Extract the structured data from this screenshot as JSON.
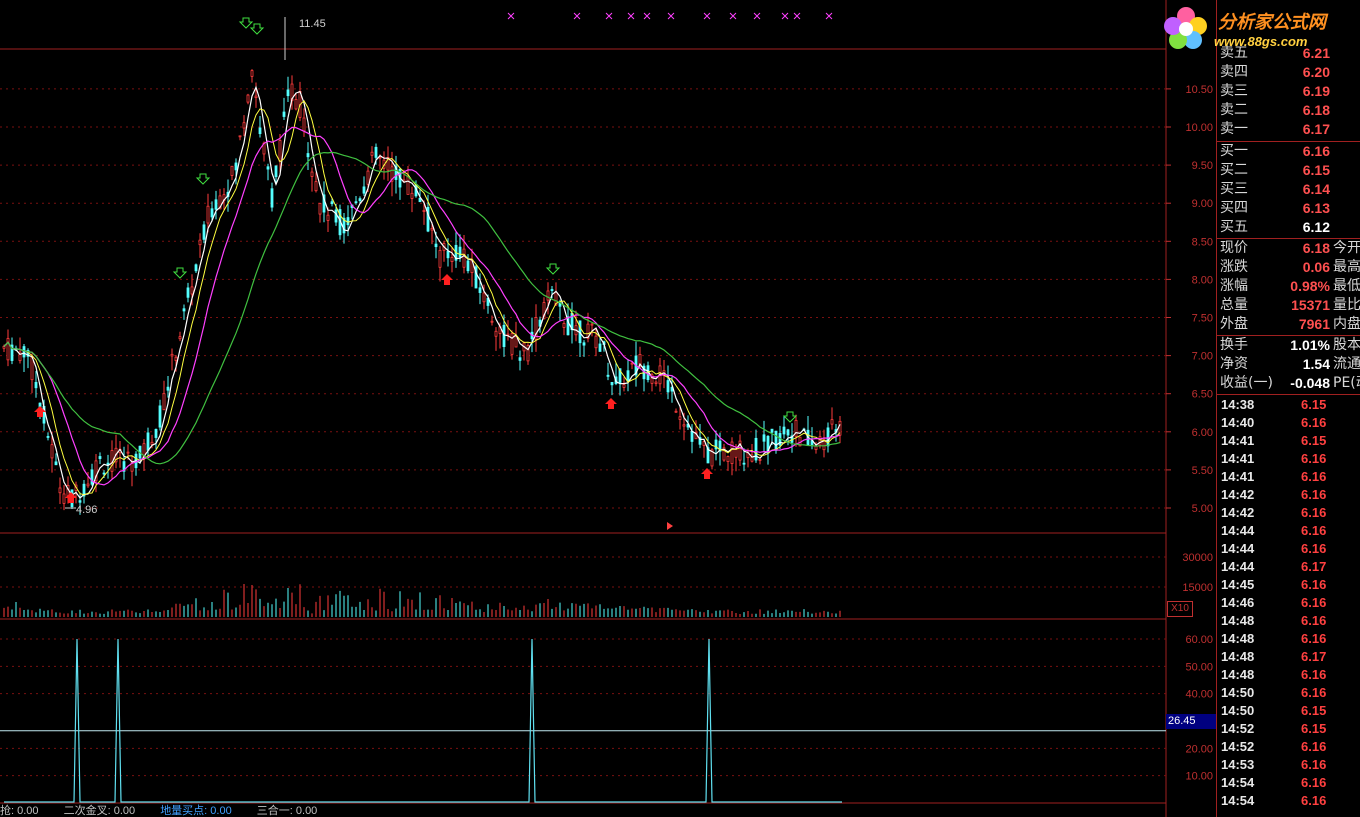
{
  "chart_area": {
    "price_axis_ticks": [
      "10.50",
      "10.00",
      "9.50",
      "9.00",
      "8.50",
      "8.00",
      "7.50",
      "7.00",
      "6.50",
      "6.00",
      "5.50",
      "5.00"
    ],
    "price_axis_values": [
      10.5,
      10.0,
      9.5,
      9.0,
      8.5,
      8.0,
      7.5,
      7.0,
      6.5,
      6.0,
      5.5,
      5.0
    ],
    "high_label": "11.45",
    "low_label": "4.96",
    "volume_axis_ticks": [
      "30000",
      "15000"
    ],
    "volume_axis_values": [
      30000,
      15000
    ],
    "volume_multiplier": "X10",
    "indicator_axis_ticks": [
      "60.00",
      "50.00",
      "40.00",
      "20.00",
      "10.00"
    ],
    "indicator_axis_values": [
      60,
      50,
      40,
      20,
      10
    ],
    "indicator_current": "26.45",
    "candle_up_color": "#ff3c3c",
    "candle_down_color": "#54ffff",
    "ma5_color": "#ffffff",
    "ma10_color": "#ffff40",
    "ma20_color": "#ff40ff",
    "ma60_color": "#40c040",
    "indicator_line_color": "#60e0f0"
  },
  "bottom_bar": {
    "items": [
      "抢: 0.00",
      "二次金叉: 0.00",
      "地量买点: 0.00",
      "三合一: 0.00"
    ]
  },
  "logo": {
    "text": "分析家公式网",
    "url": "www.88gs.com"
  },
  "quote_panel": {
    "sell": [
      {
        "label": "卖五",
        "value": "6.21"
      },
      {
        "label": "卖四",
        "value": "6.20"
      },
      {
        "label": "卖三",
        "value": "6.19"
      },
      {
        "label": "卖二",
        "value": "6.18"
      },
      {
        "label": "卖一",
        "value": "6.17"
      }
    ],
    "buy": [
      {
        "label": "买一",
        "value": "6.16"
      },
      {
        "label": "买二",
        "value": "6.15"
      },
      {
        "label": "买三",
        "value": "6.14"
      },
      {
        "label": "买四",
        "value": "6.13"
      },
      {
        "label": "买五",
        "value": "6.12"
      }
    ],
    "stats": [
      {
        "label": "现价",
        "value": "6.18",
        "extra": "今开"
      },
      {
        "label": "涨跌",
        "value": "0.06",
        "extra": "最高"
      },
      {
        "label": "涨幅",
        "value": "0.98%",
        "extra": "最低"
      },
      {
        "label": "总量",
        "value": "15371",
        "extra": "量比"
      },
      {
        "label": "外盘",
        "value": "7961",
        "extra": "内盘"
      }
    ],
    "stats2": [
      {
        "label": "换手",
        "value": "1.01%",
        "extra": "股本"
      },
      {
        "label": "净资",
        "value": "1.54",
        "extra": "流通"
      },
      {
        "label": "收益(一)",
        "value": "-0.048",
        "extra": "PE(动)"
      }
    ],
    "ticks": [
      {
        "time": "14:38",
        "price": "6.15"
      },
      {
        "time": "14:40",
        "price": "6.16"
      },
      {
        "time": "14:41",
        "price": "6.15"
      },
      {
        "time": "14:41",
        "price": "6.16"
      },
      {
        "time": "14:41",
        "price": "6.16"
      },
      {
        "time": "14:42",
        "price": "6.16"
      },
      {
        "time": "14:42",
        "price": "6.16"
      },
      {
        "time": "14:44",
        "price": "6.16"
      },
      {
        "time": "14:44",
        "price": "6.16"
      },
      {
        "time": "14:44",
        "price": "6.17"
      },
      {
        "time": "14:45",
        "price": "6.16"
      },
      {
        "time": "14:46",
        "price": "6.16"
      },
      {
        "time": "14:48",
        "price": "6.16"
      },
      {
        "time": "14:48",
        "price": "6.16"
      },
      {
        "time": "14:48",
        "price": "6.17"
      },
      {
        "time": "14:48",
        "price": "6.16"
      },
      {
        "time": "14:50",
        "price": "6.16"
      },
      {
        "time": "14:50",
        "price": "6.15"
      },
      {
        "time": "14:52",
        "price": "6.15"
      },
      {
        "time": "14:52",
        "price": "6.16"
      },
      {
        "time": "14:53",
        "price": "6.16"
      },
      {
        "time": "14:54",
        "price": "6.16"
      },
      {
        "time": "14:54",
        "price": "6.16"
      }
    ]
  }
}
